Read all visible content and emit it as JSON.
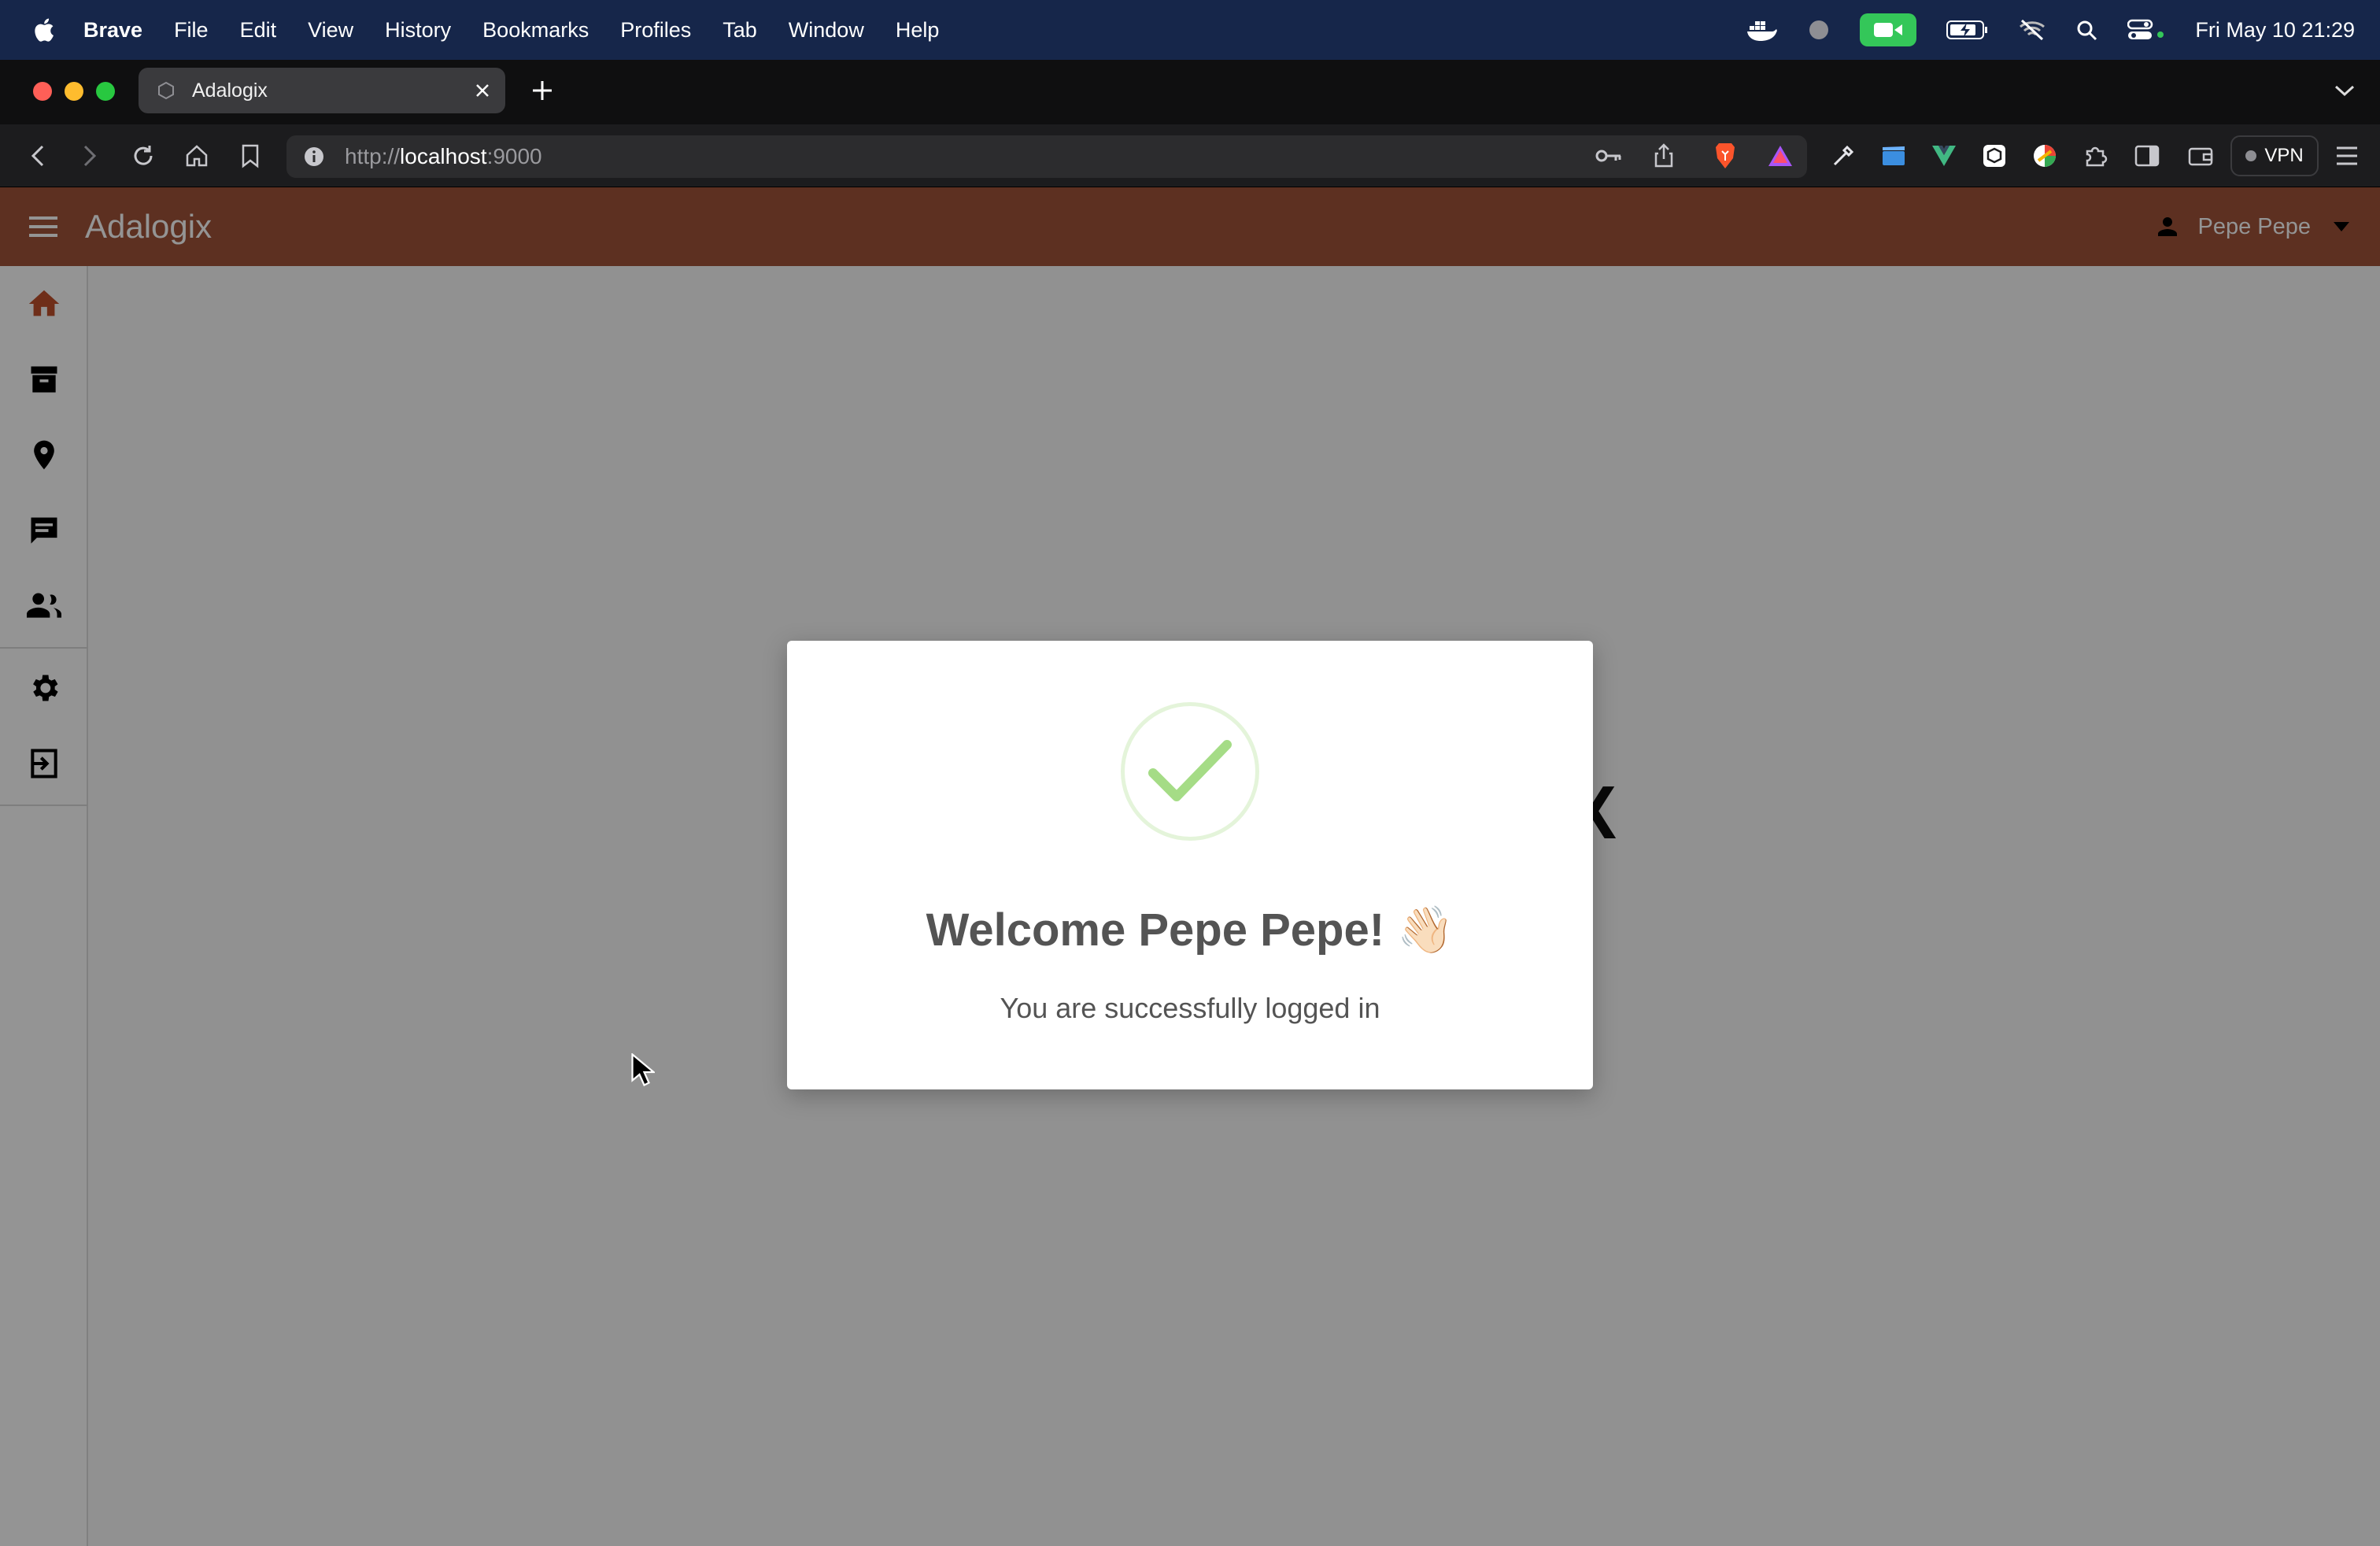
{
  "menubar": {
    "app_name": "Brave",
    "items": [
      "File",
      "Edit",
      "View",
      "History",
      "Bookmarks",
      "Profiles",
      "Tab",
      "Window",
      "Help"
    ],
    "status_icons": [
      "docker-icon",
      "record-icon",
      "facetime-icon",
      "battery-icon",
      "wifi-off-icon",
      "spotlight-icon",
      "control-center-icon"
    ],
    "clock": "Fri May 10  21:29"
  },
  "browser": {
    "tab_title": "Adalogix",
    "url_scheme": "http://",
    "url_host": "localhost",
    "url_port": ":9000",
    "vpn_label": "VPN",
    "colors": {
      "tabstrip": "#0f0f10",
      "toolbar": "#1c1c1e"
    }
  },
  "app": {
    "brand": "Adalogix",
    "user_name": "Pepe Pepe",
    "accent_color": "#a0533a",
    "nav": [
      {
        "icon": "home-icon",
        "active": true
      },
      {
        "icon": "archive-icon",
        "active": false
      },
      {
        "icon": "location-pin-icon",
        "active": false
      },
      {
        "icon": "chat-icon",
        "active": false
      },
      {
        "icon": "users-icon",
        "active": false
      },
      {
        "icon": "settings-icon",
        "active": false
      },
      {
        "icon": "logout-icon",
        "active": false
      }
    ],
    "background_letter": "X"
  },
  "modal": {
    "icon": "success-check-icon",
    "title": "Welcome Pepe Pepe! 👋🏻",
    "text": "You are successfully logged in",
    "success_color": "#a5dc86"
  }
}
